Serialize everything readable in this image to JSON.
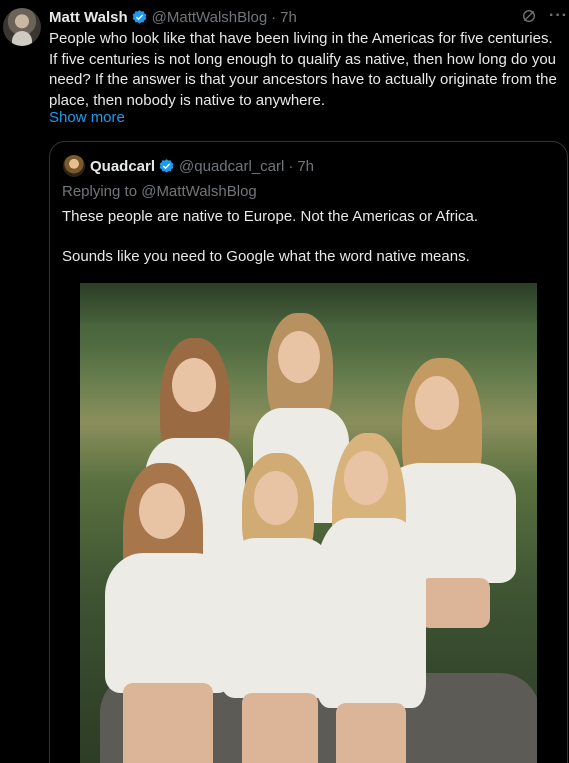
{
  "tweet": {
    "author_name": "Matt Walsh",
    "handle": "@MattWalshBlog",
    "separator": "·",
    "time": "7h",
    "text": "People who look like that have been living in the Americas for five centuries. If five centuries is not long enough to qualify as native, then how long do you need? If the answer is that your ancestors have to actually originate from the place, then nobody is native to anywhere.",
    "show_more": "Show more",
    "icons": [
      "verified-badge-icon",
      "grok-icon",
      "more-icon"
    ]
  },
  "quote": {
    "author_name": "Quadcarl",
    "handle": "@quadcarl_carl",
    "separator": "·",
    "time": "7h",
    "replying_to": "Replying to @MattWalshBlog",
    "text_line1": "These people are native to Europe. Not the Americas or Africa.",
    "text_line2": "Sounds like you need to Google what the word native means."
  },
  "colors": {
    "background": "#000000",
    "text": "#e7e9ea",
    "muted": "#71767b",
    "link": "#1d9bf0",
    "border": "#2f3336",
    "verified": "#1d9bf0"
  }
}
